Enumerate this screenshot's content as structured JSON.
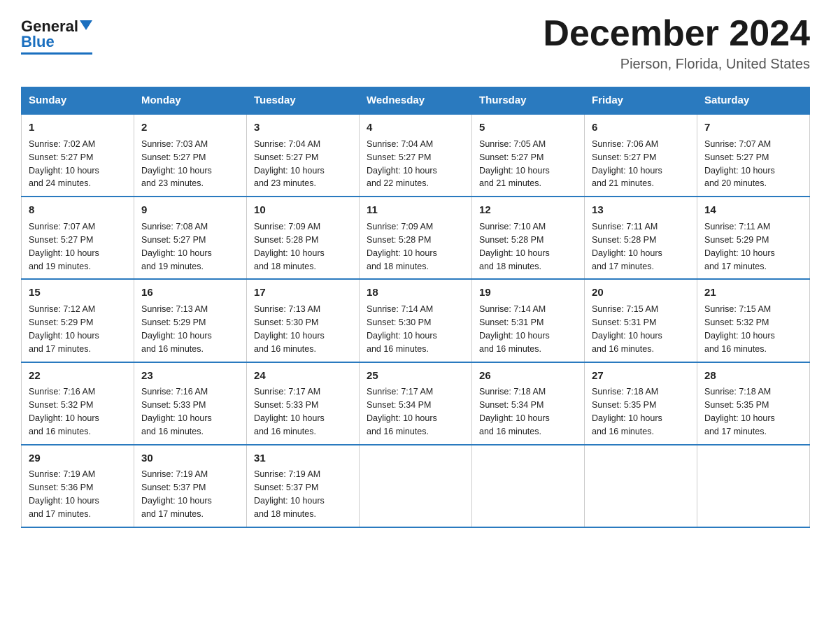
{
  "logo": {
    "general": "General",
    "blue": "Blue"
  },
  "header": {
    "month_title": "December 2024",
    "location": "Pierson, Florida, United States"
  },
  "weekdays": [
    "Sunday",
    "Monday",
    "Tuesday",
    "Wednesday",
    "Thursday",
    "Friday",
    "Saturday"
  ],
  "weeks": [
    [
      {
        "day": "1",
        "sunrise": "7:02 AM",
        "sunset": "5:27 PM",
        "daylight": "10 hours and 24 minutes."
      },
      {
        "day": "2",
        "sunrise": "7:03 AM",
        "sunset": "5:27 PM",
        "daylight": "10 hours and 23 minutes."
      },
      {
        "day": "3",
        "sunrise": "7:04 AM",
        "sunset": "5:27 PM",
        "daylight": "10 hours and 23 minutes."
      },
      {
        "day": "4",
        "sunrise": "7:04 AM",
        "sunset": "5:27 PM",
        "daylight": "10 hours and 22 minutes."
      },
      {
        "day": "5",
        "sunrise": "7:05 AM",
        "sunset": "5:27 PM",
        "daylight": "10 hours and 21 minutes."
      },
      {
        "day": "6",
        "sunrise": "7:06 AM",
        "sunset": "5:27 PM",
        "daylight": "10 hours and 21 minutes."
      },
      {
        "day": "7",
        "sunrise": "7:07 AM",
        "sunset": "5:27 PM",
        "daylight": "10 hours and 20 minutes."
      }
    ],
    [
      {
        "day": "8",
        "sunrise": "7:07 AM",
        "sunset": "5:27 PM",
        "daylight": "10 hours and 19 minutes."
      },
      {
        "day": "9",
        "sunrise": "7:08 AM",
        "sunset": "5:27 PM",
        "daylight": "10 hours and 19 minutes."
      },
      {
        "day": "10",
        "sunrise": "7:09 AM",
        "sunset": "5:28 PM",
        "daylight": "10 hours and 18 minutes."
      },
      {
        "day": "11",
        "sunrise": "7:09 AM",
        "sunset": "5:28 PM",
        "daylight": "10 hours and 18 minutes."
      },
      {
        "day": "12",
        "sunrise": "7:10 AM",
        "sunset": "5:28 PM",
        "daylight": "10 hours and 18 minutes."
      },
      {
        "day": "13",
        "sunrise": "7:11 AM",
        "sunset": "5:28 PM",
        "daylight": "10 hours and 17 minutes."
      },
      {
        "day": "14",
        "sunrise": "7:11 AM",
        "sunset": "5:29 PM",
        "daylight": "10 hours and 17 minutes."
      }
    ],
    [
      {
        "day": "15",
        "sunrise": "7:12 AM",
        "sunset": "5:29 PM",
        "daylight": "10 hours and 17 minutes."
      },
      {
        "day": "16",
        "sunrise": "7:13 AM",
        "sunset": "5:29 PM",
        "daylight": "10 hours and 16 minutes."
      },
      {
        "day": "17",
        "sunrise": "7:13 AM",
        "sunset": "5:30 PM",
        "daylight": "10 hours and 16 minutes."
      },
      {
        "day": "18",
        "sunrise": "7:14 AM",
        "sunset": "5:30 PM",
        "daylight": "10 hours and 16 minutes."
      },
      {
        "day": "19",
        "sunrise": "7:14 AM",
        "sunset": "5:31 PM",
        "daylight": "10 hours and 16 minutes."
      },
      {
        "day": "20",
        "sunrise": "7:15 AM",
        "sunset": "5:31 PM",
        "daylight": "10 hours and 16 minutes."
      },
      {
        "day": "21",
        "sunrise": "7:15 AM",
        "sunset": "5:32 PM",
        "daylight": "10 hours and 16 minutes."
      }
    ],
    [
      {
        "day": "22",
        "sunrise": "7:16 AM",
        "sunset": "5:32 PM",
        "daylight": "10 hours and 16 minutes."
      },
      {
        "day": "23",
        "sunrise": "7:16 AM",
        "sunset": "5:33 PM",
        "daylight": "10 hours and 16 minutes."
      },
      {
        "day": "24",
        "sunrise": "7:17 AM",
        "sunset": "5:33 PM",
        "daylight": "10 hours and 16 minutes."
      },
      {
        "day": "25",
        "sunrise": "7:17 AM",
        "sunset": "5:34 PM",
        "daylight": "10 hours and 16 minutes."
      },
      {
        "day": "26",
        "sunrise": "7:18 AM",
        "sunset": "5:34 PM",
        "daylight": "10 hours and 16 minutes."
      },
      {
        "day": "27",
        "sunrise": "7:18 AM",
        "sunset": "5:35 PM",
        "daylight": "10 hours and 16 minutes."
      },
      {
        "day": "28",
        "sunrise": "7:18 AM",
        "sunset": "5:35 PM",
        "daylight": "10 hours and 17 minutes."
      }
    ],
    [
      {
        "day": "29",
        "sunrise": "7:19 AM",
        "sunset": "5:36 PM",
        "daylight": "10 hours and 17 minutes."
      },
      {
        "day": "30",
        "sunrise": "7:19 AM",
        "sunset": "5:37 PM",
        "daylight": "10 hours and 17 minutes."
      },
      {
        "day": "31",
        "sunrise": "7:19 AM",
        "sunset": "5:37 PM",
        "daylight": "10 hours and 18 minutes."
      },
      null,
      null,
      null,
      null
    ]
  ],
  "sunrise_label": "Sunrise: ",
  "sunset_label": "Sunset: ",
  "daylight_label": "Daylight: "
}
